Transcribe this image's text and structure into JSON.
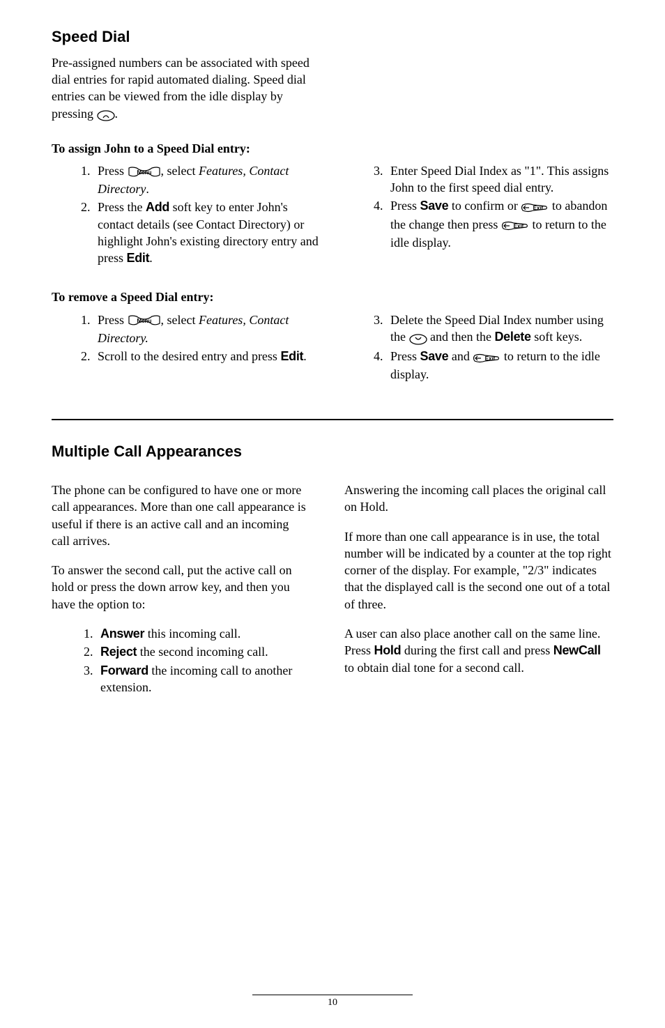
{
  "speedDial": {
    "title": "Speed Dial",
    "lead1": "Pre-assigned numbers can be associated with speed dial entries for rapid automated dialing.  Speed dial entries can be viewed from the idle display by pressing  ",
    "lead1_end": ".",
    "assignTitle": "To assign John to a Speed Dial entry:",
    "assign_left": {
      "li1a": "Press ",
      "li1b": ", select ",
      "li1c": "Features, Contact Directory",
      "li1d": ".",
      "li2a": "Press the ",
      "li2_add": "Add",
      "li2b": " soft key to enter John's contact details (see Contact Directory) or highlight John's existing directory entry and press ",
      "li2_edit": "Edit",
      "li2c": "."
    },
    "assign_right": {
      "li3a": "Enter Speed Dial Index as \"1\".  This assigns John to the first speed dial entry.",
      "li4a": "Press ",
      "li4_save": "Save",
      "li4b": " to confirm or ",
      "li4c": " to abandon the change then press ",
      "li4d": " to return to the idle display."
    },
    "removeTitle": "To remove a Speed Dial entry:",
    "remove_left": {
      "li1a": "Press ",
      "li1b": ", select ",
      "li1c": "Features, Contact Directory.",
      "li2a": "Scroll to the desired entry and press ",
      "li2_edit": "Edit",
      "li2b": "."
    },
    "remove_right": {
      "li3a": "Delete the Speed Dial Index number using the ",
      "li3b": " and then the ",
      "li3_delete": "Delete",
      "li3c": " soft keys.",
      "li4a": "Press ",
      "li4_save": "Save",
      "li4b": " and ",
      "li4c": " to return to the idle display."
    }
  },
  "multi": {
    "title": "Multiple Call Appearances",
    "left": {
      "p1": "The phone can be configured to have one or more call appearances.  More than one call appearance is useful if there is an active call and an incoming call arrives.",
      "p2": "To answer the second call, put the active call on hold or press the down arrow key, and then you have the option to:",
      "li1_sk": "Answer",
      "li1_txt": " this incoming call.",
      "li2_sk": "Reject",
      "li2_txt": " the second incoming call.",
      "li3_sk": "Forward",
      "li3_txt": " the incoming call to another extension."
    },
    "right": {
      "p1": "Answering the incoming call places the original call on Hold.",
      "p2": "If more than one call appearance is in use, the total number will be indicated by a counter at the top right corner of the display.  For example, \"2/3\" indicates that the displayed call is the second one out of a total of three.",
      "p3a": "A user can also place another call on the same line.  Press ",
      "p3_hold": "Hold",
      "p3b": " during the first call and press ",
      "p3_newcall": "NewCall",
      "p3c": " to obtain dial tone for a second call."
    }
  },
  "icons": {
    "menu": "Menu",
    "exit": "Exit"
  },
  "footer": {
    "page": "10"
  }
}
